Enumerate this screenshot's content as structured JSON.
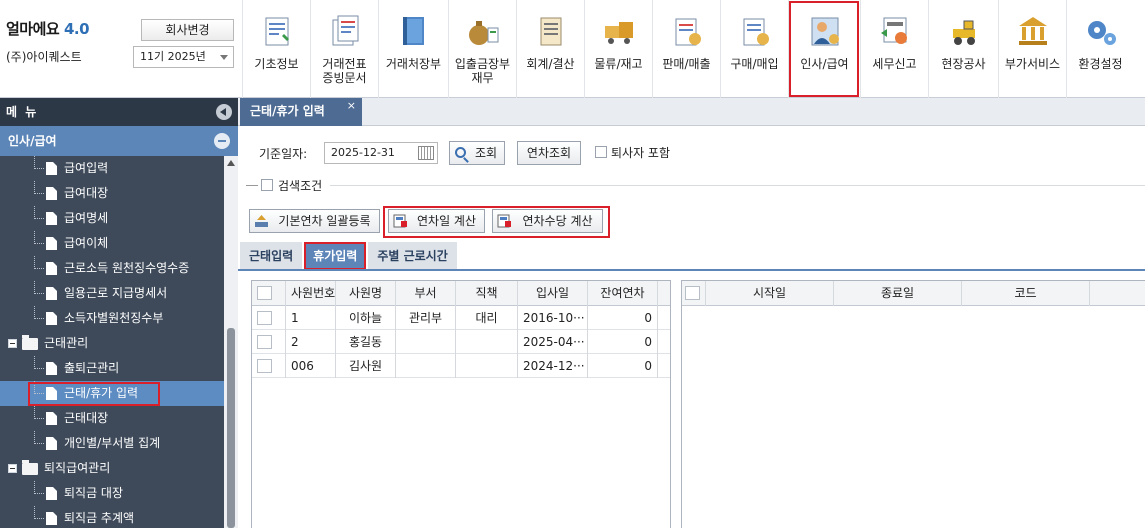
{
  "brand": {
    "name": "얼마에요",
    "version": "4.0",
    "company": "(주)아이퀘스트",
    "change_company": "회사변경",
    "period": "11기 2025년"
  },
  "menus": [
    {
      "label": "기초정보",
      "icon": "basic-info-icon"
    },
    {
      "label": "거래전표\n증빙문서",
      "icon": "voucher-icon"
    },
    {
      "label": "거래처장부",
      "icon": "ledger-book-icon"
    },
    {
      "label": "입출금장부\n재무",
      "icon": "money-bag-icon"
    },
    {
      "label": "회계/결산",
      "icon": "accounting-icon"
    },
    {
      "label": "물류/재고",
      "icon": "logistics-icon"
    },
    {
      "label": "판매/매출",
      "icon": "sales-icon"
    },
    {
      "label": "구매/매입",
      "icon": "purchase-icon"
    },
    {
      "label": "인사/급여",
      "icon": "hr-payroll-icon"
    },
    {
      "label": "세무신고",
      "icon": "tax-report-icon"
    },
    {
      "label": "현장공사",
      "icon": "construction-icon"
    },
    {
      "label": "부가서비스",
      "icon": "bank-building-icon"
    },
    {
      "label": "환경설정",
      "icon": "settings-gear-icon"
    }
  ],
  "sidebar": {
    "header": "메 뉴",
    "section": "인사/급여",
    "items": [
      {
        "label": "급여입력",
        "type": "leaf"
      },
      {
        "label": "급여대장",
        "type": "leaf"
      },
      {
        "label": "급여명세",
        "type": "leaf"
      },
      {
        "label": "급여이체",
        "type": "leaf"
      },
      {
        "label": "근로소득 원천징수영수증",
        "type": "leaf"
      },
      {
        "label": "일용근로 지급명세서",
        "type": "leaf"
      },
      {
        "label": "소득자별원천징수부",
        "type": "leaf"
      },
      {
        "label": "근태관리",
        "type": "folder"
      },
      {
        "label": "출퇴근관리",
        "type": "leaf"
      },
      {
        "label": "근태/휴가 입력",
        "type": "leaf",
        "active": true
      },
      {
        "label": "근태대장",
        "type": "leaf"
      },
      {
        "label": "개인별/부서별 집계",
        "type": "leaf"
      },
      {
        "label": "퇴직급여관리",
        "type": "folder"
      },
      {
        "label": "퇴직금 대장",
        "type": "leaf"
      },
      {
        "label": "퇴직금 추계액",
        "type": "leaf"
      }
    ]
  },
  "tab": {
    "title": "근태/휴가 입력",
    "close": "×"
  },
  "filters": {
    "date_label": "기준일자:",
    "date_value": "2025-12-31",
    "search_btn": "조회",
    "annual_search_btn": "연차조회",
    "include_retired": "퇴사자 포함",
    "search_conditions": "검색조건"
  },
  "actions": {
    "bulk_register": "기본연차 일괄등록",
    "calc_days": "연차일 계산",
    "calc_allowance": "연차수당 계산"
  },
  "subtabs": [
    "근태입력",
    "휴가입력",
    "주별 근로시간"
  ],
  "left_grid": {
    "columns": [
      "사원번호",
      "사원명",
      "부서",
      "직책",
      "입사일",
      "잔여연차"
    ],
    "rows": [
      [
        "1",
        "이하늘",
        "관리부",
        "대리",
        "2016-10···",
        "0"
      ],
      [
        "2",
        "홍길동",
        "",
        "",
        "2025-04···",
        "0"
      ],
      [
        "006",
        "김사원",
        "",
        "",
        "2024-12···",
        "0"
      ]
    ]
  },
  "right_grid": {
    "columns": [
      "시작일",
      "종료일",
      "코드"
    ]
  },
  "colors": {
    "accent": "#5e85b8",
    "sidebar_bg": "#3e4a5a",
    "highlight": "#d9202a"
  }
}
